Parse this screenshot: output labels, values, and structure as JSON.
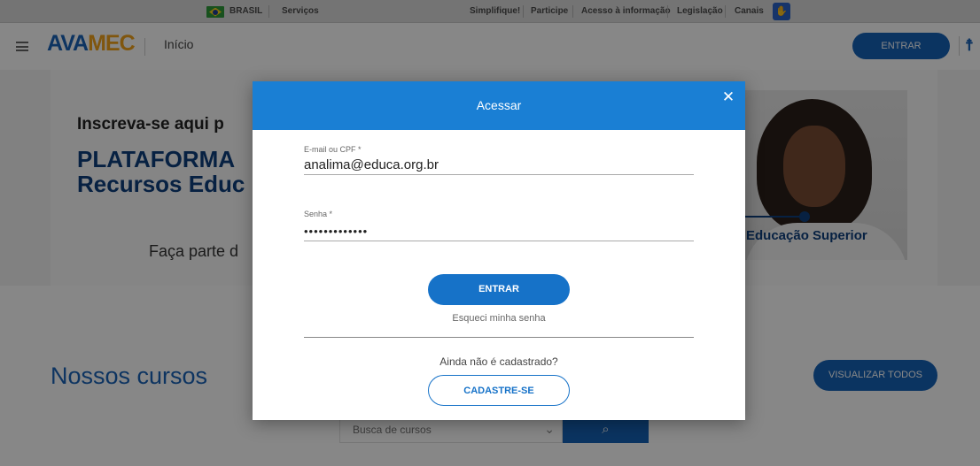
{
  "govbar": {
    "country": "BRASIL",
    "links": [
      "Serviços",
      "Simplifique!",
      "Participe",
      "Acesso à informação",
      "Legislação",
      "Canais"
    ]
  },
  "header": {
    "logo_part1": "AVA",
    "logo_part2": "MEC",
    "breadcrumb": "Início",
    "login_button": "ENTRAR"
  },
  "banner": {
    "line1": "Inscreva-se aqui p",
    "line2": "PLATAFORMA",
    "line3": "Recursos Educ",
    "line4": "Faça parte d",
    "image_label": "Educação Superior"
  },
  "courses": {
    "heading": "Nossos cursos",
    "view_all_button": "VISUALIZAR TODOS",
    "search_placeholder": "Busca de cursos"
  },
  "modal": {
    "title": "Acessar",
    "email_label": "E-mail ou CPF *",
    "email_value": "analima@educa.org.br",
    "password_label": "Senha *",
    "password_value": "•••••••••••••",
    "submit_button": "ENTRAR",
    "forgot_link": "Esqueci minha senha",
    "not_registered_text": "Ainda não é cadastrado?",
    "register_button": "CADASTRE-SE"
  },
  "colors": {
    "brand_blue": "#1562b8",
    "modal_header": "#1a7fd4",
    "logo_orange": "#f2a31b"
  }
}
